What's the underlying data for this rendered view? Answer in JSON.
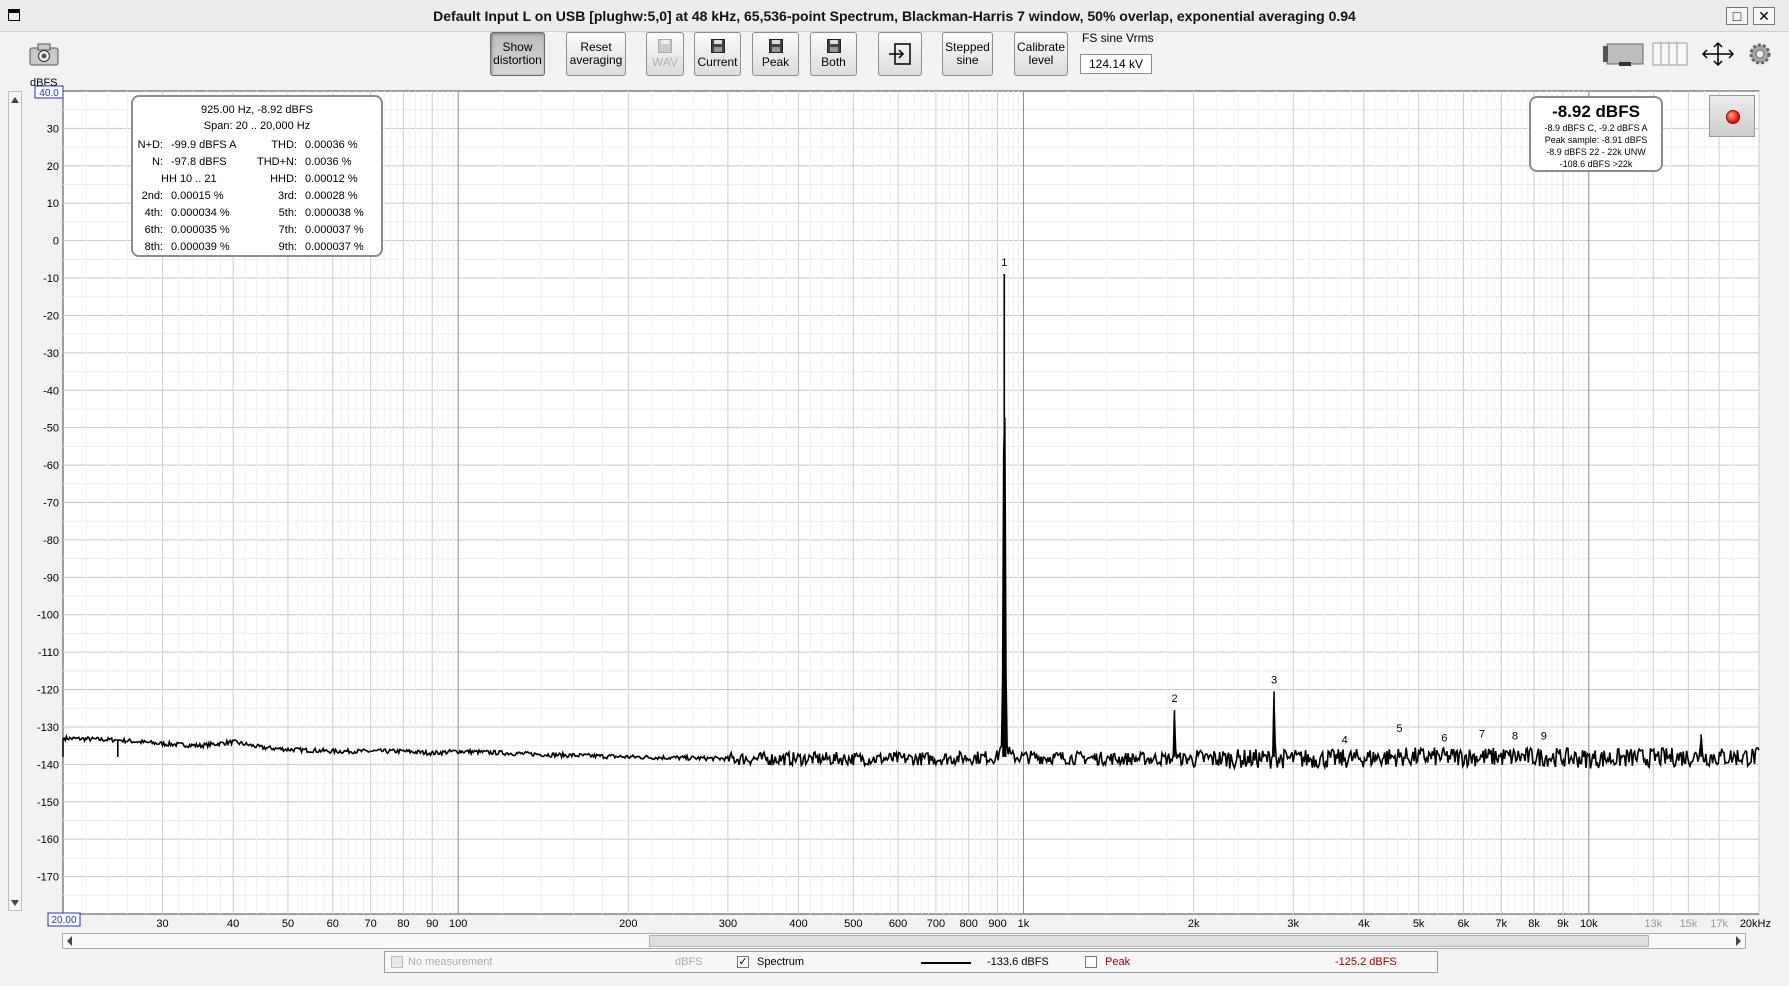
{
  "window": {
    "title": "Default Input L on USB [plughw:5,0] at 48 kHz, 65,536-point Spectrum, Blackman-Harris 7 window, 50% overlap, exponential averaging 0.94",
    "maximize_glyph": "□",
    "close_glyph": "✕"
  },
  "toolbar": {
    "show_distortion": [
      "Show",
      "distortion"
    ],
    "reset_averaging": [
      "Reset",
      "averaging"
    ],
    "wav": "WAV",
    "current": "Current",
    "peak": "Peak",
    "both": "Both",
    "stepped_sine": [
      "Stepped",
      "sine"
    ],
    "calibrate_level": [
      "Calibrate",
      "level"
    ],
    "fs_sine_label": "FS sine Vrms",
    "fs_sine_value": "124.14 kV",
    "export_glyph": "⇥",
    "move_glyph": "↔"
  },
  "stats": {
    "header": "925.00 Hz, -8.92 dBFS",
    "span": "Span: 20 .. 20,000 Hz",
    "rows": [
      [
        "N+D:",
        "-99.9 dBFS A",
        "THD:",
        "0.00036 %"
      ],
      [
        "N:",
        "-97.8 dBFS",
        "THD+N:",
        "0.0036 %"
      ],
      [
        "HH 10 .. 21",
        "",
        "HHD:",
        "0.00012 %"
      ],
      [
        "2nd:",
        "0.00015 %",
        "3rd:",
        "0.00028 %"
      ],
      [
        "4th:",
        "0.000034 %",
        "5th:",
        "0.000038 %"
      ],
      [
        "6th:",
        "0.000035 %",
        "7th:",
        "0.000037 %"
      ],
      [
        "8th:",
        "0.000039 %",
        "9th:",
        "0.000037 %"
      ]
    ]
  },
  "level": {
    "big": "-8.92 dBFS",
    "lines": [
      "-8.9 dBFS C, -9.2 dBFS A",
      "Peak sample: -8.91 dBFS",
      "-8.9 dBFS 22 - 22k UNW",
      "-108.6 dBFS >22k"
    ]
  },
  "legend": {
    "no_measurement": "No measurement",
    "unit": "dBFS",
    "spectrum": "Spectrum",
    "spectrum_value": "-133.6 dBFS",
    "peak": "Peak",
    "peak_value": "-125.2 dBFS",
    "checked_glyph": "✓"
  },
  "chart_data": {
    "type": "line",
    "ylabel": "dBFS",
    "xlabel_unit": "Hz",
    "x_scale": "log",
    "xlim": [
      20,
      20000
    ],
    "ylim": [
      -180,
      40
    ],
    "top_field": "40.0",
    "left_field": "20.00",
    "grid": true,
    "y_ticks": [
      30,
      20,
      10,
      0,
      -10,
      -20,
      -30,
      -40,
      -50,
      -60,
      -70,
      -80,
      -90,
      -100,
      -110,
      -120,
      -130,
      -140,
      -150,
      -160,
      -170
    ],
    "x_ticks": [
      {
        "v": 30,
        "label": "30"
      },
      {
        "v": 40,
        "label": "40"
      },
      {
        "v": 50,
        "label": "50"
      },
      {
        "v": 60,
        "label": "60"
      },
      {
        "v": 70,
        "label": "70"
      },
      {
        "v": 80,
        "label": "80"
      },
      {
        "v": 90,
        "label": "90"
      },
      {
        "v": 100,
        "label": "100"
      },
      {
        "v": 200,
        "label": "200"
      },
      {
        "v": 300,
        "label": "300"
      },
      {
        "v": 400,
        "label": "400"
      },
      {
        "v": 500,
        "label": "500"
      },
      {
        "v": 600,
        "label": "600"
      },
      {
        "v": 700,
        "label": "700"
      },
      {
        "v": 800,
        "label": "800"
      },
      {
        "v": 900,
        "label": "900"
      },
      {
        "v": 1000,
        "label": "1k"
      },
      {
        "v": 2000,
        "label": "2k"
      },
      {
        "v": 3000,
        "label": "3k"
      },
      {
        "v": 4000,
        "label": "4k"
      },
      {
        "v": 5000,
        "label": "5k"
      },
      {
        "v": 6000,
        "label": "6k"
      },
      {
        "v": 7000,
        "label": "7k"
      },
      {
        "v": 8000,
        "label": "8k"
      },
      {
        "v": 9000,
        "label": "9k"
      },
      {
        "v": 10000,
        "label": "10k"
      },
      {
        "v": 13000,
        "label": "13k"
      },
      {
        "v": 15000,
        "label": "15k"
      },
      {
        "v": 17000,
        "label": "17k"
      },
      {
        "v": 20000,
        "label": "20kHz"
      }
    ],
    "series": [
      {
        "points": [
          [
            20,
            -133
          ],
          [
            25,
            -133.5
          ],
          [
            30,
            -134.5
          ],
          [
            35,
            -135
          ],
          [
            40,
            -134
          ],
          [
            45,
            -135.5
          ],
          [
            50,
            -136
          ],
          [
            60,
            -136.5
          ],
          [
            70,
            -136.5
          ],
          [
            80,
            -136.5
          ],
          [
            90,
            -137
          ],
          [
            100,
            -136.5
          ],
          [
            150,
            -137.5
          ],
          [
            200,
            -138
          ],
          [
            300,
            -138.5
          ],
          [
            500,
            -138.5
          ],
          [
            700,
            -138.5
          ],
          [
            900,
            -138
          ],
          [
            915,
            -135
          ],
          [
            920,
            -110
          ],
          [
            925,
            -8.92
          ],
          [
            930,
            -110
          ],
          [
            935,
            -135
          ],
          [
            950,
            -138
          ],
          [
            1500,
            -138.5
          ],
          [
            1840,
            -138.5
          ],
          [
            1850,
            -125.5
          ],
          [
            1860,
            -138.5
          ],
          [
            2760,
            -138.5
          ],
          [
            2775,
            -120.5
          ],
          [
            2790,
            -138.5
          ],
          [
            3700,
            -138.5
          ],
          [
            4625,
            -138
          ],
          [
            5550,
            -138
          ],
          [
            6475,
            -138
          ],
          [
            7400,
            -138
          ],
          [
            8325,
            -138
          ],
          [
            10000,
            -138.5
          ],
          [
            15000,
            -138
          ],
          [
            15700,
            -138
          ],
          [
            15800,
            -132
          ],
          [
            15900,
            -138
          ],
          [
            20000,
            -138
          ]
        ]
      }
    ],
    "harmonic_markers": [
      {
        "label": "1",
        "f": 925,
        "db": -8.92
      },
      {
        "label": "2",
        "f": 1850,
        "db": -125.5
      },
      {
        "label": "3",
        "f": 2775,
        "db": -120.5
      },
      {
        "label": "4",
        "f": 3700,
        "db": -136.5
      },
      {
        "label": "5",
        "f": 4625,
        "db": -133.5
      },
      {
        "label": "6",
        "f": 5550,
        "db": -136
      },
      {
        "label": "7",
        "f": 6475,
        "db": -135
      },
      {
        "label": "8",
        "f": 7400,
        "db": -135.5
      },
      {
        "label": "9",
        "f": 8325,
        "db": -135.5
      }
    ]
  }
}
